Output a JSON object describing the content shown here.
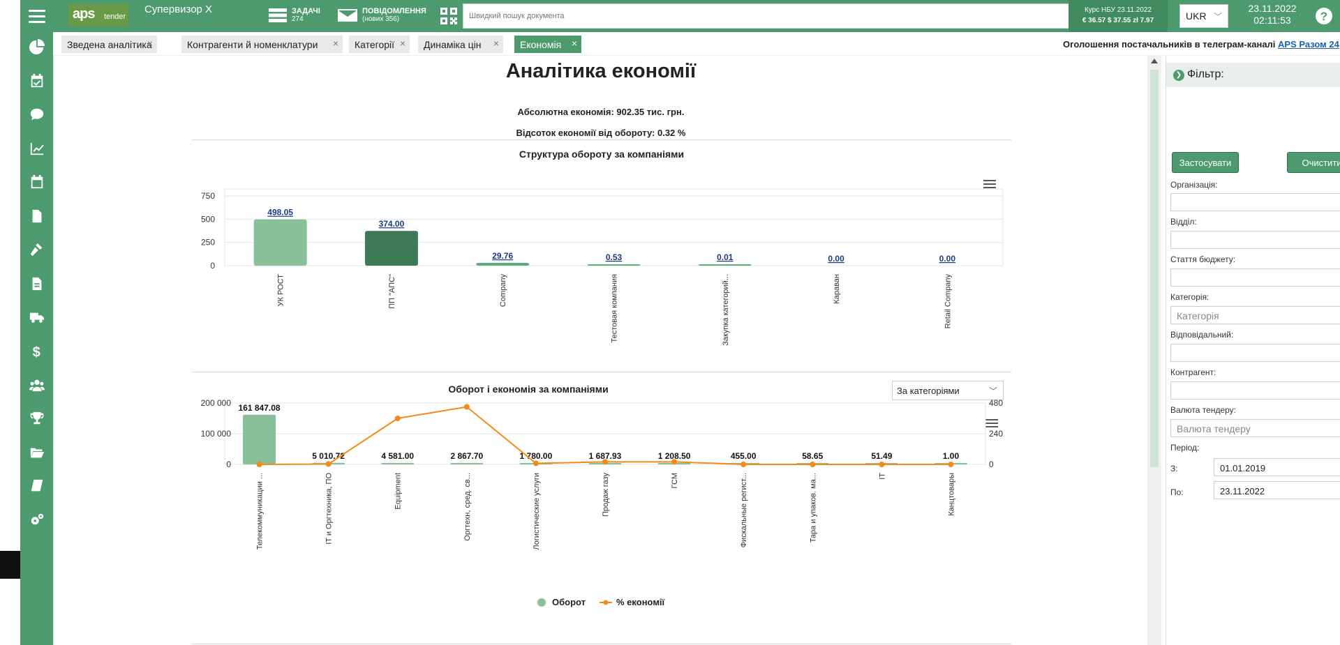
{
  "topbar": {
    "logo_main": "aps",
    "logo_sub": "tender",
    "user": "Супервизор X",
    "tasks_label": "ЗАДАЧІ",
    "tasks_count": "274",
    "messages_label": "ПОВІДОМЛЕННЯ",
    "messages_sub": "(нових 356)",
    "search_placeholder": "Швидкий пошук документа",
    "rates_title": "Курс НБУ 23.11.2022",
    "rates_values": "€ 36.57  $ 37.55  zł 7.97",
    "lang": "UKR",
    "date": "23.11.2022",
    "time": "02:11:53"
  },
  "tabs": [
    {
      "label": "Зведена аналітика",
      "active": false
    },
    {
      "label": "Контрагенти й номенклатури",
      "active": false
    },
    {
      "label": "Категорії",
      "active": false
    },
    {
      "label": "Динаміка цін",
      "active": false
    },
    {
      "label": "Економія",
      "active": true
    }
  ],
  "announcement": {
    "text": "Оголошення постачальників в телеграм-каналі",
    "link": "APS Разом 24"
  },
  "main": {
    "title": "Аналітика економії",
    "absolute_saving": "Абсолютна економія: 902.35 тис. грн.",
    "saving_percent": "Відсоток економії від обороту: 0.32 %",
    "group_select": "За категоріями"
  },
  "chart_data": [
    {
      "type": "bar",
      "title": "Структура обороту за компаніями",
      "categories": [
        "УК РОСТ",
        "ПП \"АПС\"",
        "Company",
        "Тестовая компания",
        "Закупка категорий...",
        "Караван",
        "Retail Company"
      ],
      "values": [
        498.05,
        374.0,
        29.76,
        0.53,
        0.01,
        0.0,
        0.0
      ],
      "labels": [
        "498.05",
        "374.00",
        "29.76",
        "0.53",
        "0.01",
        "0.00",
        "0.00"
      ],
      "colors": [
        "#88c09a",
        "#3e7a56",
        "#5ab07c",
        "#5ab07c",
        "#5ab07c",
        "#5ab07c",
        "#5ab07c"
      ],
      "yticks": [
        "0",
        "250",
        "500",
        "750"
      ],
      "ylim": [
        0,
        750
      ]
    },
    {
      "type": "bar",
      "title": "Оборот і економія за компаніями",
      "categories": [
        "Телекоммуникации ...",
        "IT и Оргтехника, ПО",
        "Equipment",
        "Оргтехн, сред. св...",
        "Логистические услуги",
        "Продаж газу",
        "ГСМ",
        "Фискальные регист...",
        "Тара и упаков. ма...",
        "IT",
        "Канцтовары"
      ],
      "series": [
        {
          "name": "Оборот",
          "values": [
            161847.08,
            5010.72,
            4581.0,
            2867.7,
            1780.0,
            1687.93,
            1208.5,
            455.0,
            58.65,
            51.49,
            1.0
          ],
          "labels": [
            "161 847.08",
            "5 010.72",
            "4 581.00",
            "2 867.70",
            "1 780.00",
            "1 687.93",
            "1 208.50",
            "455.00",
            "58.65",
            "51.49",
            "1.00"
          ],
          "color": "#88c09a"
        },
        {
          "name": "% економії",
          "values": [
            0,
            3,
            360,
            450,
            8,
            20,
            20,
            0,
            0,
            0,
            0
          ],
          "color": "#f5891a"
        }
      ],
      "yticks_left": [
        "0",
        "100 000",
        "200 000"
      ],
      "ylim_left": [
        0,
        200000
      ],
      "yticks_right": [
        "0",
        "240",
        "480"
      ],
      "ylim_right": [
        0,
        480
      ]
    }
  ],
  "filter": {
    "title": "Фільтр:",
    "apply": "Застосувати",
    "clear": "Очистити",
    "org_label": "Організація:",
    "dept_label": "Відділ:",
    "budget_label": "Стаття бюджету:",
    "category_label": "Категорія:",
    "category_placeholder": "Категорія",
    "responsible_label": "Відповідальний:",
    "contractor_label": "Контрагент:",
    "currency_label": "Валюта тендеру:",
    "currency_placeholder": "Валюта тендеру",
    "period_label": "Період:",
    "from_label": "З:",
    "from_value": "01.01.2019",
    "to_label": "По:",
    "to_value": "23.11.2022"
  }
}
